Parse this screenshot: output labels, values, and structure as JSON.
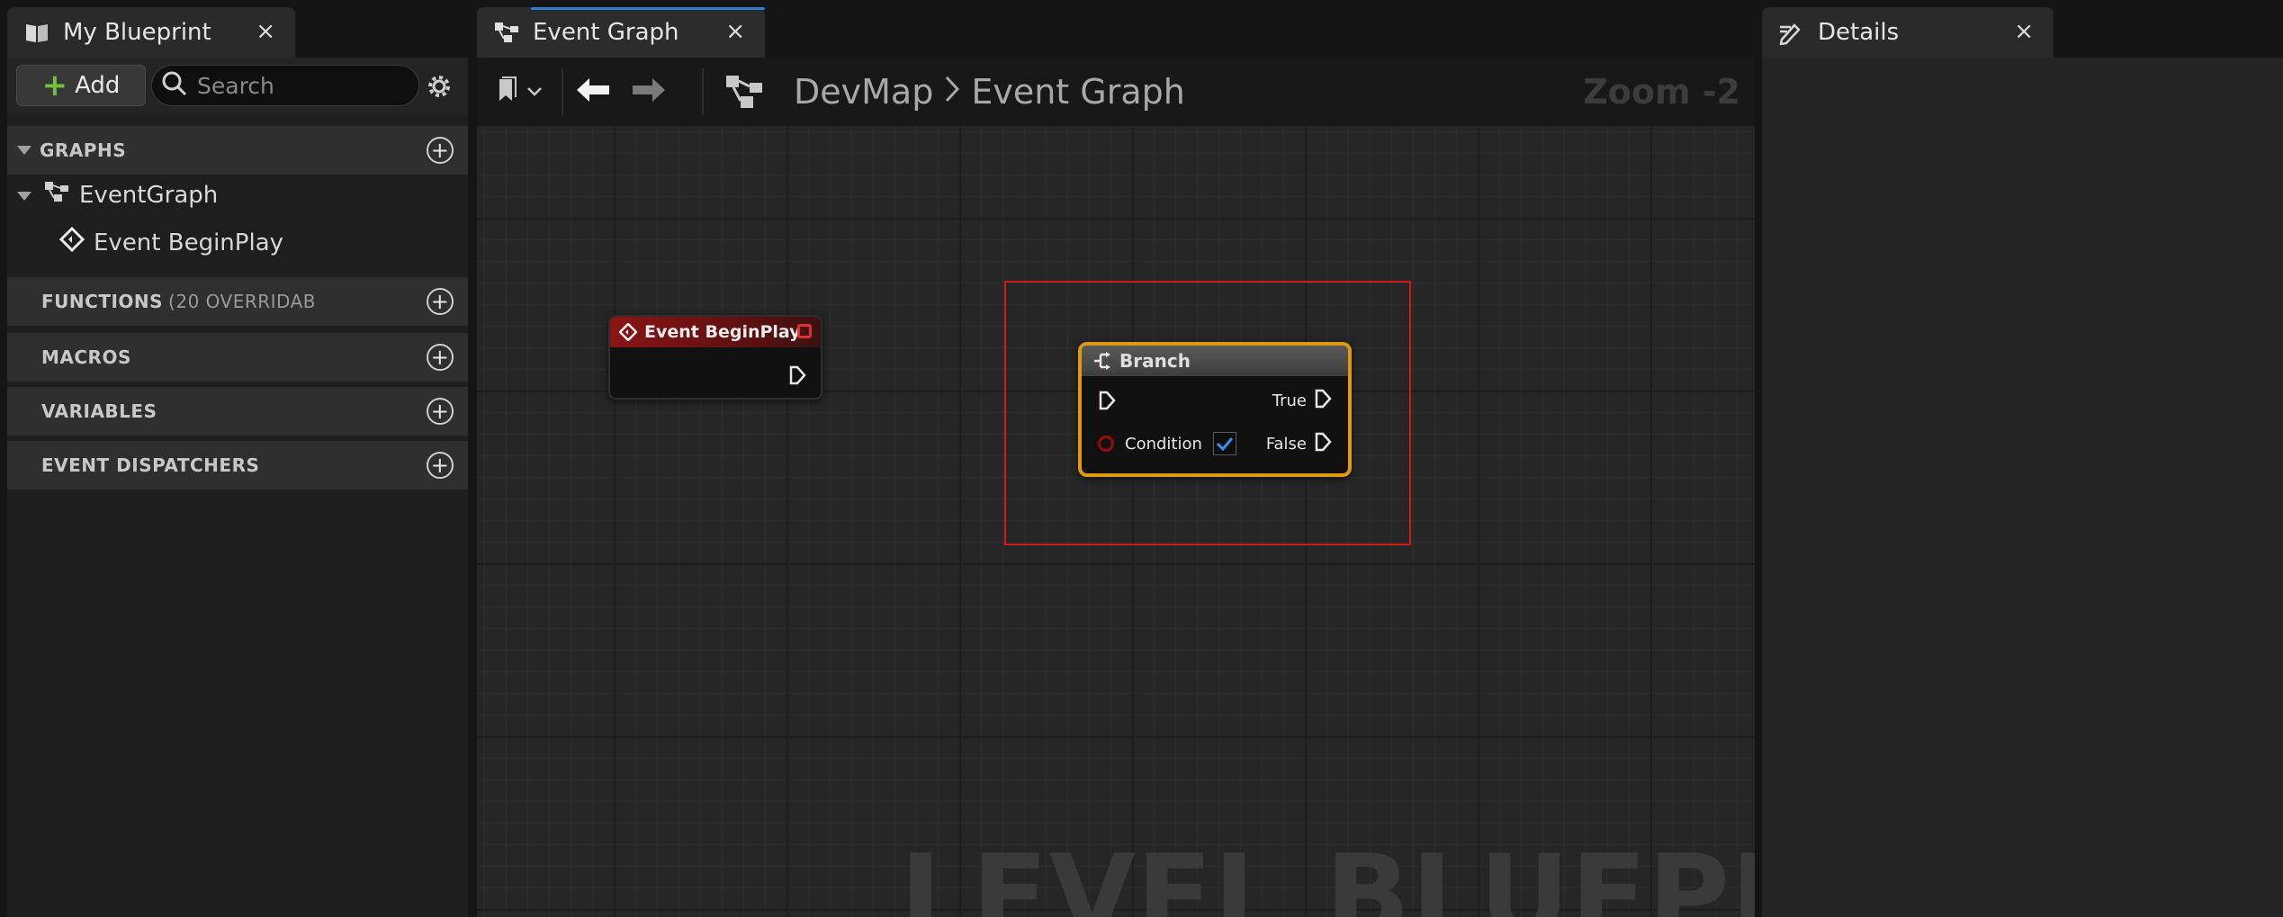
{
  "my_blueprint": {
    "tab_title": "My Blueprint",
    "close_glyph": "×",
    "add_label": "Add",
    "search_placeholder": "Search",
    "sections": {
      "graphs": "GRAPHS",
      "functions": "FUNCTIONS",
      "functions_count": "(20 OVERRIDAB",
      "macros": "MACROS",
      "variables": "VARIABLES",
      "event_dispatchers": "EVENT DISPATCHERS"
    },
    "tree": {
      "event_graph": "EventGraph",
      "event_begin_play": "Event BeginPlay"
    }
  },
  "graph_editor": {
    "tab_title": "Event Graph",
    "close_glyph": "×",
    "breadcrumb": [
      "DevMap",
      "Event Graph"
    ],
    "zoom": "Zoom -2",
    "watermark": "LEVEL BLUEPRINT",
    "nodes": {
      "begin_play": {
        "title": "Event BeginPlay",
        "color": "#8a1414"
      },
      "branch": {
        "title": "Branch",
        "pins": {
          "condition": "Condition",
          "true": "True",
          "false": "False"
        },
        "condition_checked": true,
        "selected_color": "#e09a12"
      }
    },
    "selection_color": "#d01a1a"
  },
  "details": {
    "tab_title": "Details",
    "close_glyph": "×"
  },
  "icons": [
    "blueprint-book-icon",
    "close-icon",
    "plus-icon",
    "search-icon",
    "gear-icon",
    "add-circle-icon",
    "triangle-down-icon",
    "graph-icon",
    "event-icon",
    "bookmark-icon",
    "chevron-down-icon",
    "arrow-left-icon",
    "arrow-right-icon",
    "chevron-right-icon",
    "exec-pin-icon",
    "delegate-pin-icon",
    "branch-icon",
    "checkmark-icon",
    "pencil-icon"
  ]
}
